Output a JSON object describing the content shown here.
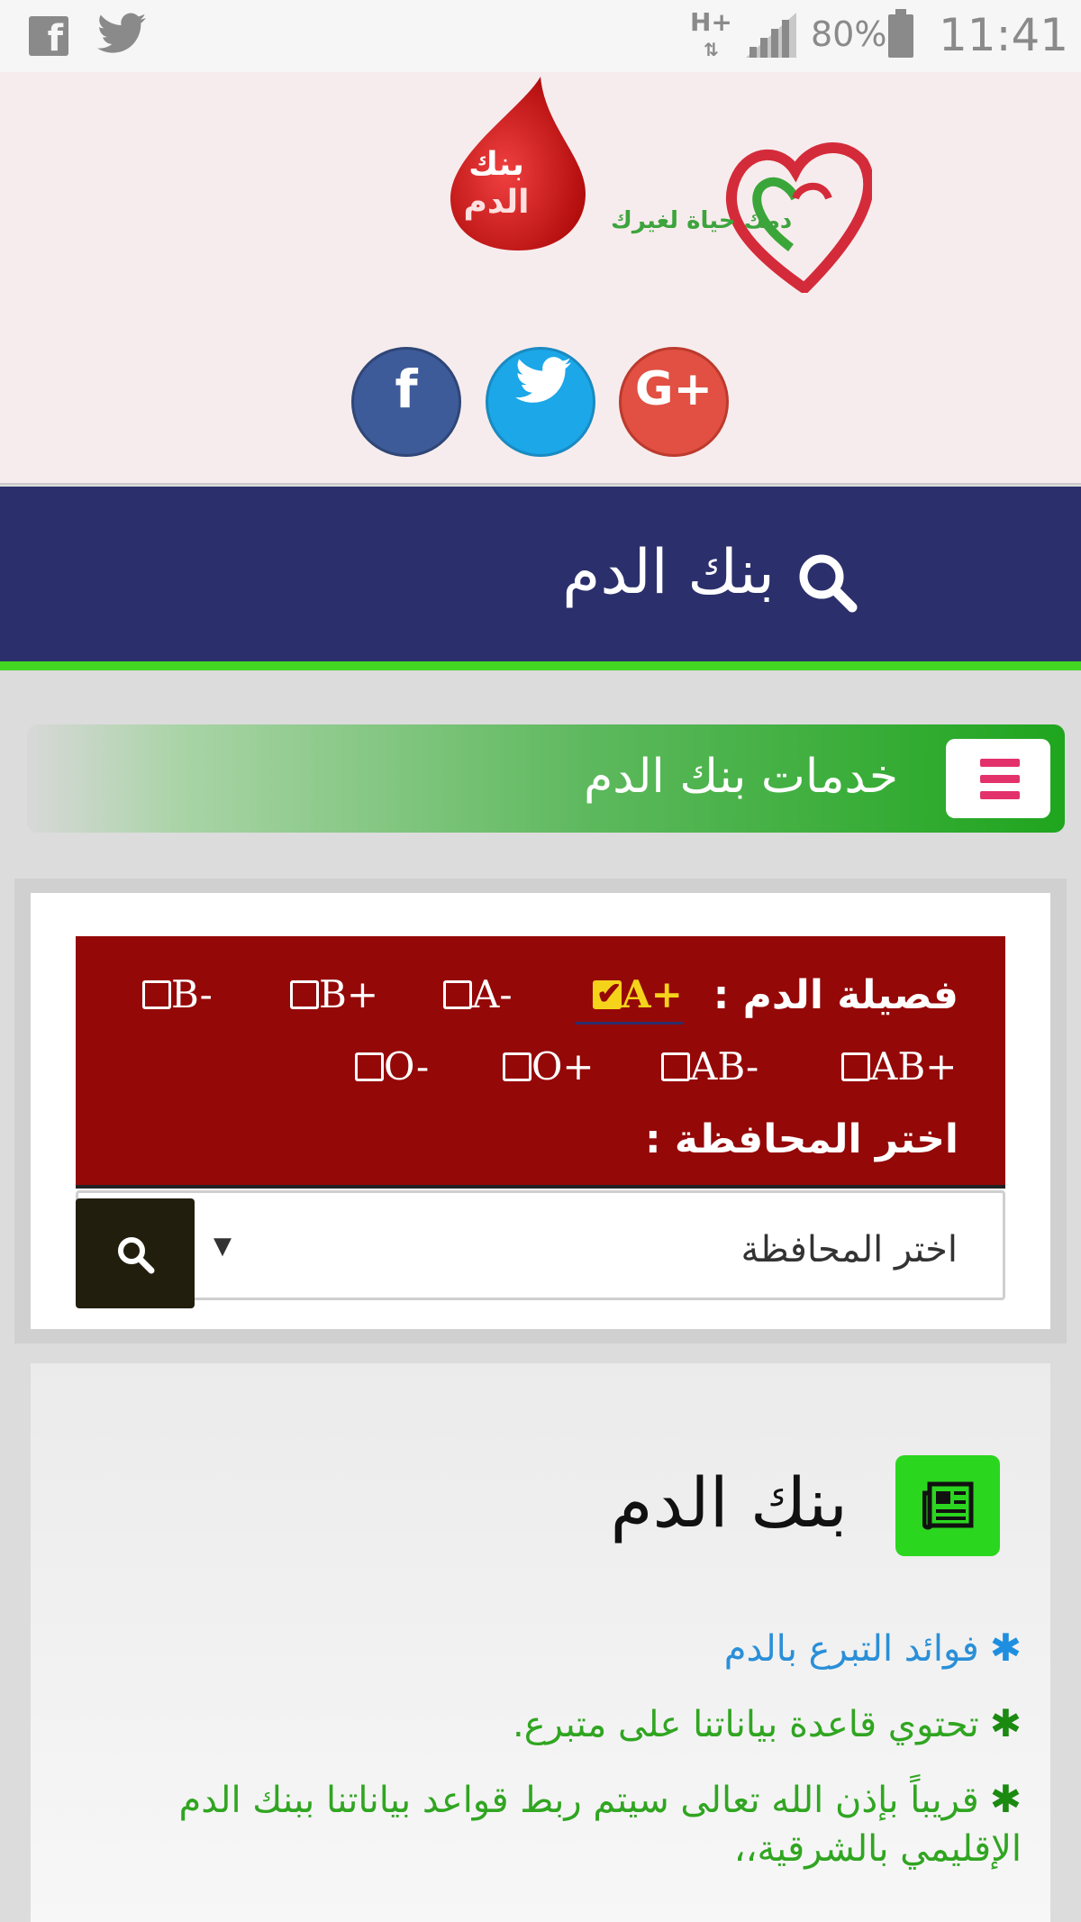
{
  "status_bar": {
    "network": "H+",
    "battery_pct": "80%",
    "time": "11:41",
    "icons": [
      "facebook-icon",
      "twitter-icon",
      "signal-icon",
      "battery-icon"
    ]
  },
  "header": {
    "tagline": "دمك حياة لغيرك",
    "logo_line1": "بنك",
    "logo_line2": "الدم",
    "social": [
      {
        "name": "facebook",
        "glyph": "f",
        "color": "#3e5b99"
      },
      {
        "name": "twitter",
        "glyph": "t",
        "color": "#1ba7e8"
      },
      {
        "name": "google-plus",
        "glyph": "G+",
        "color": "#e15042"
      }
    ]
  },
  "nav": {
    "title": "بنك الدم"
  },
  "services_banner": {
    "label": "خدمات بنك الدم"
  },
  "filter": {
    "blood_type_label": "فصيلة الدم :",
    "blood_types": [
      {
        "label": "A+",
        "checked": true
      },
      {
        "label": "A-",
        "checked": false
      },
      {
        "label": "B+",
        "checked": false
      },
      {
        "label": "B-",
        "checked": false
      },
      {
        "label": "AB+",
        "checked": false
      },
      {
        "label": "AB-",
        "checked": false
      },
      {
        "label": "O+",
        "checked": false
      },
      {
        "label": "O-",
        "checked": false
      }
    ],
    "governorate_label": "اختر المحافظة :",
    "governorate_select": {
      "selected": "اختر المحافظة"
    }
  },
  "bank_section": {
    "title": "بنك الدم",
    "items": [
      {
        "text": "فوائد التبرع بالدم",
        "color": "#2a8fd8"
      },
      {
        "text": "تحتوي قاعدة بياناتنا على متبرع.",
        "color": "#30a521"
      },
      {
        "text": "قريباً بإذن الله تعالى سيتم ربط قواعد بياناتنا ببنك الدم الإقليمي بالشرقية،،",
        "color": "#30a521"
      }
    ]
  },
  "colors": {
    "navy": "#2b2f6b",
    "accent_green": "#43d622",
    "panel_red": "#950808",
    "checked_yellow": "#f5d31b"
  }
}
